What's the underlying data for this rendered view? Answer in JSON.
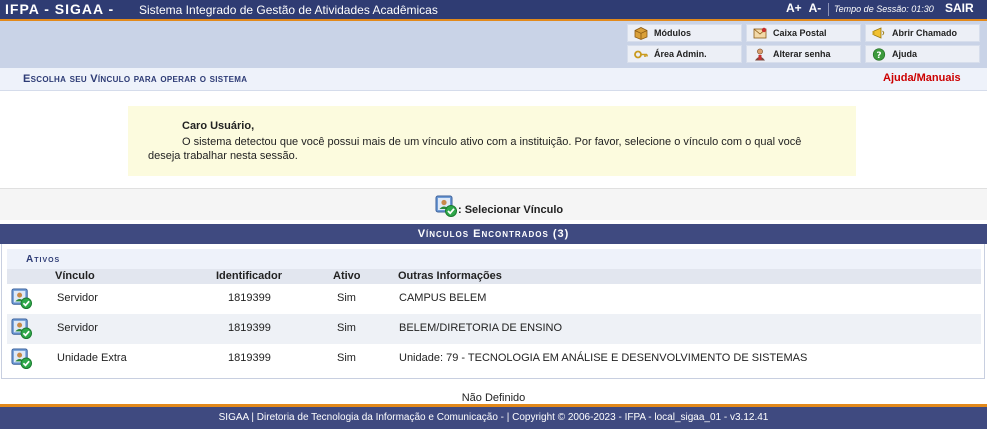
{
  "header": {
    "institution": "IFPA - SIGAA -",
    "system_name": "Sistema Integrado de Gestão de Atividades Acadêmicas",
    "font_increase": "A+",
    "font_decrease": "A-",
    "session_time": "Tempo de Sessão: 01:30",
    "logout": "SAIR"
  },
  "menu": {
    "modulos": "Módulos",
    "caixa_postal": "Caixa Postal",
    "abrir_chamado": "Abrir Chamado",
    "area_admin": "Área Admin.",
    "alterar_senha": "Alterar senha",
    "ajuda": "Ajuda"
  },
  "page": {
    "title": "Escolha seu Vínculo para operar o sistema",
    "help_link": "Ajuda/Manuais"
  },
  "message": {
    "greeting": "Caro Usuário,",
    "line1": "O sistema detectou que você possui mais de um vínculo ativo com a instituição. Por favor, selecione o vínculo com o qual você",
    "line2": "deseja trabalhar nesta sessão."
  },
  "legend": {
    "select_label": ": Selecionar Vínculo"
  },
  "table": {
    "caption": "Vínculos Encontrados (3)",
    "group": "Ativos",
    "columns": [
      "Vínculo",
      "Identificador",
      "Ativo",
      "Outras Informações"
    ],
    "rows": [
      {
        "vinculo": "Servidor",
        "identificador": "1819399",
        "ativo": "Sim",
        "info": "CAMPUS BELEM"
      },
      {
        "vinculo": "Servidor",
        "identificador": "1819399",
        "ativo": "Sim",
        "info": "BELEM/DIRETORIA DE ENSINO"
      },
      {
        "vinculo": "Unidade Extra",
        "identificador": "1819399",
        "ativo": "Sim",
        "info": "Unidade: 79 - TECNOLOGIA EM ANÁLISE E DESENVOLVIMENTO DE SISTEMAS"
      }
    ]
  },
  "footer": {
    "not_defined": "Não Definido",
    "text": "SIGAA | Diretoria de Tecnologia da Informação e Comunicação - | Copyright © 2006-2023 - IFPA - local_sigaa_01 - v3.12.41"
  },
  "colors": {
    "header_bg": "#2f3c73",
    "accent_orange": "#e2891b",
    "menu_bg": "#c9d3e7",
    "caption_bg": "#3f4a80",
    "help_red": "#cc0000",
    "message_bg": "#fcfbde"
  }
}
